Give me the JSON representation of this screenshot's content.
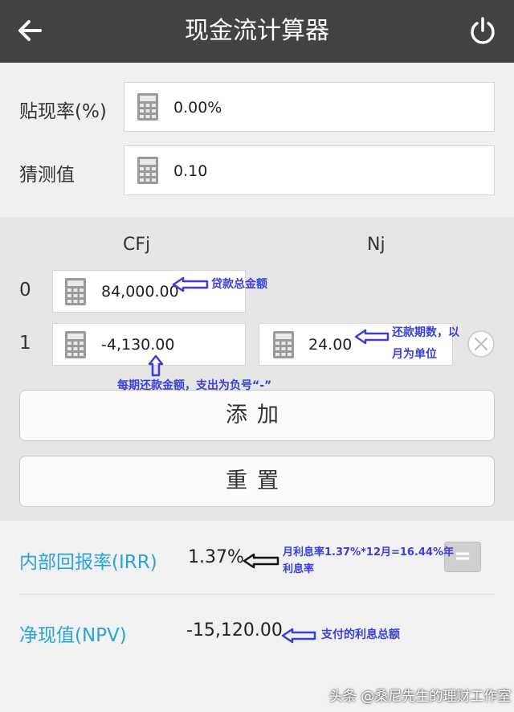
{
  "header": {
    "title": "现金流计算器",
    "back_icon": "arrow-left-icon",
    "power_icon": "power-icon"
  },
  "discount": {
    "label": "贴现率(%)",
    "value": "0.00%"
  },
  "guess": {
    "label": "猜测值",
    "value": "0.10"
  },
  "cashflow": {
    "col_cfj": "CFj",
    "col_nj": "Nj",
    "rows": [
      {
        "index": "0",
        "cfj": "84,000.00"
      },
      {
        "index": "1",
        "cfj": "-4,130.00",
        "nj": "24.00"
      }
    ]
  },
  "buttons": {
    "add": "添加",
    "reset": "重置"
  },
  "results": {
    "irr_label": "内部回报率(IRR)",
    "irr_value": "1.37%",
    "npv_label": "净现值(NPV)",
    "npv_value": "-15,120.00",
    "equals_label": "="
  },
  "annotations": {
    "loan_total": "贷款总金额",
    "periods_line1": "还款期数，以",
    "periods_line2": "月为单位",
    "payment": "每期还款金额，支出为负号“-”",
    "irr_line1": "月利息率1.37%*12月=16.44%年",
    "irr_line2": "利息率",
    "npv": "支付的利息总额"
  },
  "watermark": "头条 @桑尼先生的理财工作室",
  "colors": {
    "header_bg": "#424242",
    "result_label": "#2aa3d6",
    "annotation": "#3a3fd8"
  }
}
